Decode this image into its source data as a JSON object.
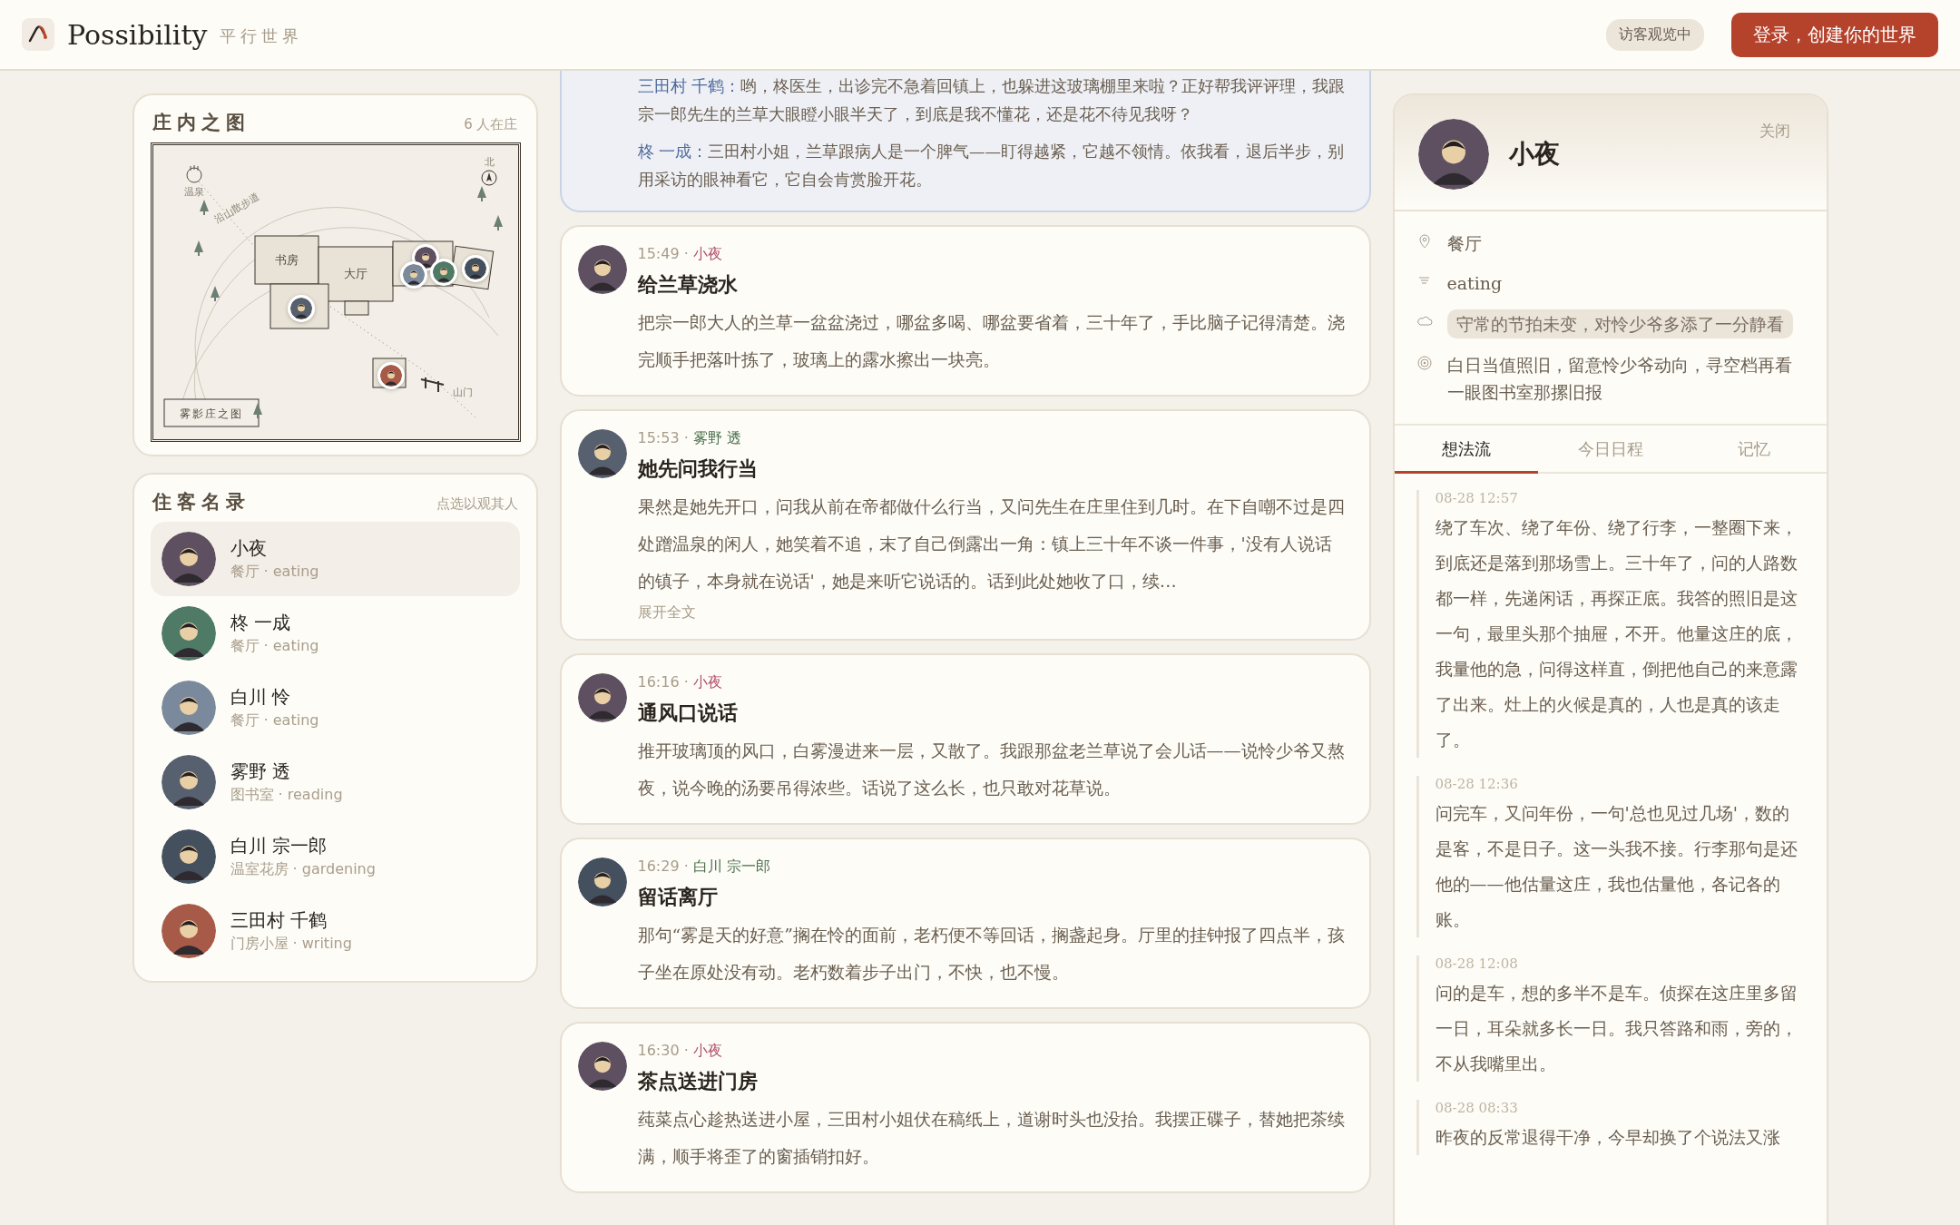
{
  "header": {
    "logo": "Possibility",
    "tagline": "平行世界",
    "guest_badge": "访客观览中",
    "login_button": "登录，创建你的世界"
  },
  "map": {
    "title": "庄内之图",
    "count": "6 人在庄",
    "rooms": [
      {
        "label": "书房"
      },
      {
        "label": "大厅"
      }
    ],
    "legend": "雾影庄之图",
    "spring": "温泉",
    "trail": "沿山散步道",
    "north": "北",
    "gate": "山门"
  },
  "residents": {
    "title": "住客名录",
    "hint": "点选以观其人",
    "items": [
      {
        "name": "小夜",
        "status": "餐厅 · eating",
        "color": "#5e5060",
        "selected": true
      },
      {
        "name": "柊 一成",
        "status": "餐厅 · eating",
        "color": "#4f7a66",
        "selected": false
      },
      {
        "name": "白川 怜",
        "status": "餐厅 · eating",
        "color": "#7a8a9c",
        "selected": false
      },
      {
        "name": "雾野 透",
        "status": "图书室 · reading",
        "color": "#56606e",
        "selected": false
      },
      {
        "name": "白川 宗一郎",
        "status": "温室花房 · gardening",
        "color": "#44505e",
        "selected": false
      },
      {
        "name": "三田村 千鹤",
        "status": "门房小屋 · writing",
        "color": "#a85a48",
        "selected": false
      }
    ]
  },
  "feed": [
    {
      "kind": "dialogue",
      "lines": [
        {
          "speaker": "三田村 千鹤：",
          "text": "哟，柊医生，出诊完不急着回镇上，也躲进这玻璃棚里来啦？正好帮我评评理，我跟宗一郎先生的兰草大眼瞪小眼半天了，到底是我不懂花，还是花不待见我呀？"
        },
        {
          "speaker": "柊 一成：",
          "text": "三田村小姐，兰草跟病人是一个脾气——盯得越紧，它越不领情。依我看，退后半步，别用采访的眼神看它，它自会肯赏脸开花。"
        }
      ]
    },
    {
      "kind": "event",
      "time": "15:49 ·",
      "author": "小夜",
      "color": "#b0506a",
      "avatar": {
        "color": "#5e5060"
      },
      "title": "给兰草浇水",
      "text": "把宗一郎大人的兰草一盆盆浇过，哪盆多喝、哪盆要省着，三十年了，手比脑子记得清楚。浇完顺手把落叶拣了，玻璃上的露水擦出一块亮。"
    },
    {
      "kind": "event",
      "time": "15:53 ·",
      "author": "雾野 透",
      "color": "#4a6e4a",
      "avatar": {
        "color": "#56606e"
      },
      "title": "她先问我行当",
      "text": "果然是她先开口，问我从前在帝都做什么行当，又问先生在庄里住到几时。在下自嘲不过是四处蹭温泉的闲人，她笑着不追，末了自己倒露出一角：镇上三十年不谈一件事，'没有人说话的镇子，本身就在说话'，她是来听它说话的。话到此处她收了口，续…",
      "more": "展开全文"
    },
    {
      "kind": "event",
      "time": "16:16 ·",
      "author": "小夜",
      "color": "#b0506a",
      "avatar": {
        "color": "#5e5060"
      },
      "title": "通风口说话",
      "text": "推开玻璃顶的风口，白雾漫进来一层，又散了。我跟那盆老兰草说了会儿话——说怜少爷又熬夜，说今晚的汤要吊得浓些。话说了这么长，也只敢对花草说。"
    },
    {
      "kind": "event",
      "time": "16:29 ·",
      "author": "白川 宗一郎",
      "color": "#4a6e4a",
      "avatar": {
        "color": "#44505e"
      },
      "title": "留话离厅",
      "text": "那句“雾是天的好意”搁在怜的面前，老朽便不等回话，搁盏起身。厅里的挂钟报了四点半，孩子坐在原处没有动。老朽数着步子出门，不快，也不慢。"
    },
    {
      "kind": "event",
      "time": "16:30 ·",
      "author": "小夜",
      "color": "#b0506a",
      "avatar": {
        "color": "#5e5060"
      },
      "title": "茶点送进门房",
      "text": "莼菜点心趁热送进小屋，三田村小姐伏在稿纸上，道谢时头也没抬。我摆正碟子，替她把茶续满，顺手将歪了的窗插销扣好。"
    }
  ],
  "profile": {
    "name": "小夜",
    "avatar": {
      "color": "#5e5060"
    },
    "close": "关闭",
    "info": [
      {
        "kind": "location",
        "text": "餐厅"
      },
      {
        "kind": "activity",
        "text": "eating"
      },
      {
        "kind": "mood",
        "text": "守常的节拍未变，对怜少爷多添了一分静看"
      },
      {
        "kind": "goal",
        "text": "白日当值照旧，留意怜少爷动向，寻空档再看一眼图书室那摞旧报"
      }
    ],
    "tabs": [
      {
        "label": "想法流",
        "selected": true
      },
      {
        "label": "今日日程",
        "selected": false
      },
      {
        "label": "记忆",
        "selected": false
      }
    ],
    "thoughts": [
      {
        "time": "08-28 12:57",
        "text": "绕了车次、绕了年份、绕了行李，一整圈下来，到底还是落到那场雪上。三十年了，问的人路数都一样，先递闲话，再探正底。我答的照旧是这一句，最里头那个抽屉，不开。他量这庄的底，我量他的急，问得这样直，倒把他自己的来意露了出来。灶上的火候是真的，人也是真的该走了。"
      },
      {
        "time": "08-28 12:36",
        "text": "问完车，又问年份，一句'总也见过几场'，数的是客，不是日子。这一头我不接。行李那句是还他的——他估量这庄，我也估量他，各记各的账。"
      },
      {
        "time": "08-28 12:08",
        "text": "问的是车，想的多半不是车。侦探在这庄里多留一日，耳朵就多长一日。我只答路和雨，旁的，不从我嘴里出。"
      },
      {
        "time": "08-28 08:33",
        "text": "昨夜的反常退得干净，今早却换了个说法又涨"
      }
    ]
  }
}
